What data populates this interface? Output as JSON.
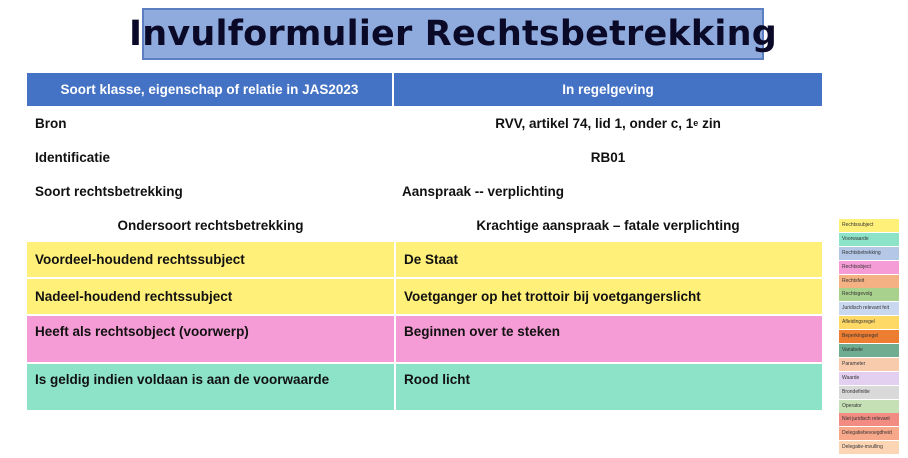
{
  "title": "Invulformulier Rechtsbetrekking",
  "table": {
    "header_left": "Soort klasse, eigenschap of relatie in JAS2023",
    "header_right": "In regelgeving",
    "rows": [
      {
        "left": "Bron",
        "right_main": "RVV, artikel 74, lid 1, onder c, 1",
        "right_sup": "e",
        "right_tail": " zin"
      },
      {
        "left": "Identificatie",
        "right": "RB01"
      },
      {
        "left": "Soort rechtsbetrekking",
        "right": "Aanspraak -- verplichting"
      },
      {
        "left": "Ondersoort rechtsbetrekking",
        "right": "Krachtige aanspraak – fatale verplichting"
      },
      {
        "left": "Voordeel-houdend rechtssubject",
        "right": "De Staat"
      },
      {
        "left": "Nadeel-houdend rechtssubject",
        "right": "Voetganger op het trottoir bij voetgangerslicht"
      },
      {
        "left": "Heeft als rechtsobject (voorwerp)",
        "right": "Beginnen over te steken"
      },
      {
        "left": "Is geldig indien voldaan is aan de voorwaarde",
        "right": "Rood licht"
      }
    ]
  },
  "colors": {
    "header": "#4472c4",
    "title_box": "#8faadc",
    "yellow": "#fff07a",
    "pink": "#f59bd5",
    "teal": "#8ce3c8"
  },
  "legend": [
    {
      "label": "Rechtssubject",
      "color": "#fff07a"
    },
    {
      "label": "Voorwaarde",
      "color": "#8ce3c8"
    },
    {
      "label": "Rechtsbetrekking",
      "color": "#b4c7e7"
    },
    {
      "label": "Rechtsobject",
      "color": "#f59bd5"
    },
    {
      "label": "Rechtsfeit",
      "color": "#f4b183"
    },
    {
      "label": "Rechtsgevolg",
      "color": "#a9d18e"
    },
    {
      "label": "Juridisch relevant feit",
      "color": "#c9d8ef"
    },
    {
      "label": "Afleidingsregel",
      "color": "#ffd966"
    },
    {
      "label": "Beperkingsregel",
      "color": "#ed7d31"
    },
    {
      "label": "Variabele",
      "color": "#70ad90"
    },
    {
      "label": "Parameter",
      "color": "#f8cbad"
    },
    {
      "label": "Waarde",
      "color": "#e3d0f0"
    },
    {
      "label": "Brondefinitie",
      "color": "#d9d9d9"
    },
    {
      "label": "Operator",
      "color": "#c5e0b4"
    },
    {
      "label": "Niet juridisch relevant",
      "color": "#f28b82"
    },
    {
      "label": "Delegatiebevoegdheid",
      "color": "#f8a88a"
    },
    {
      "label": "Delegatie-invulling",
      "color": "#fcd5b4"
    }
  ]
}
